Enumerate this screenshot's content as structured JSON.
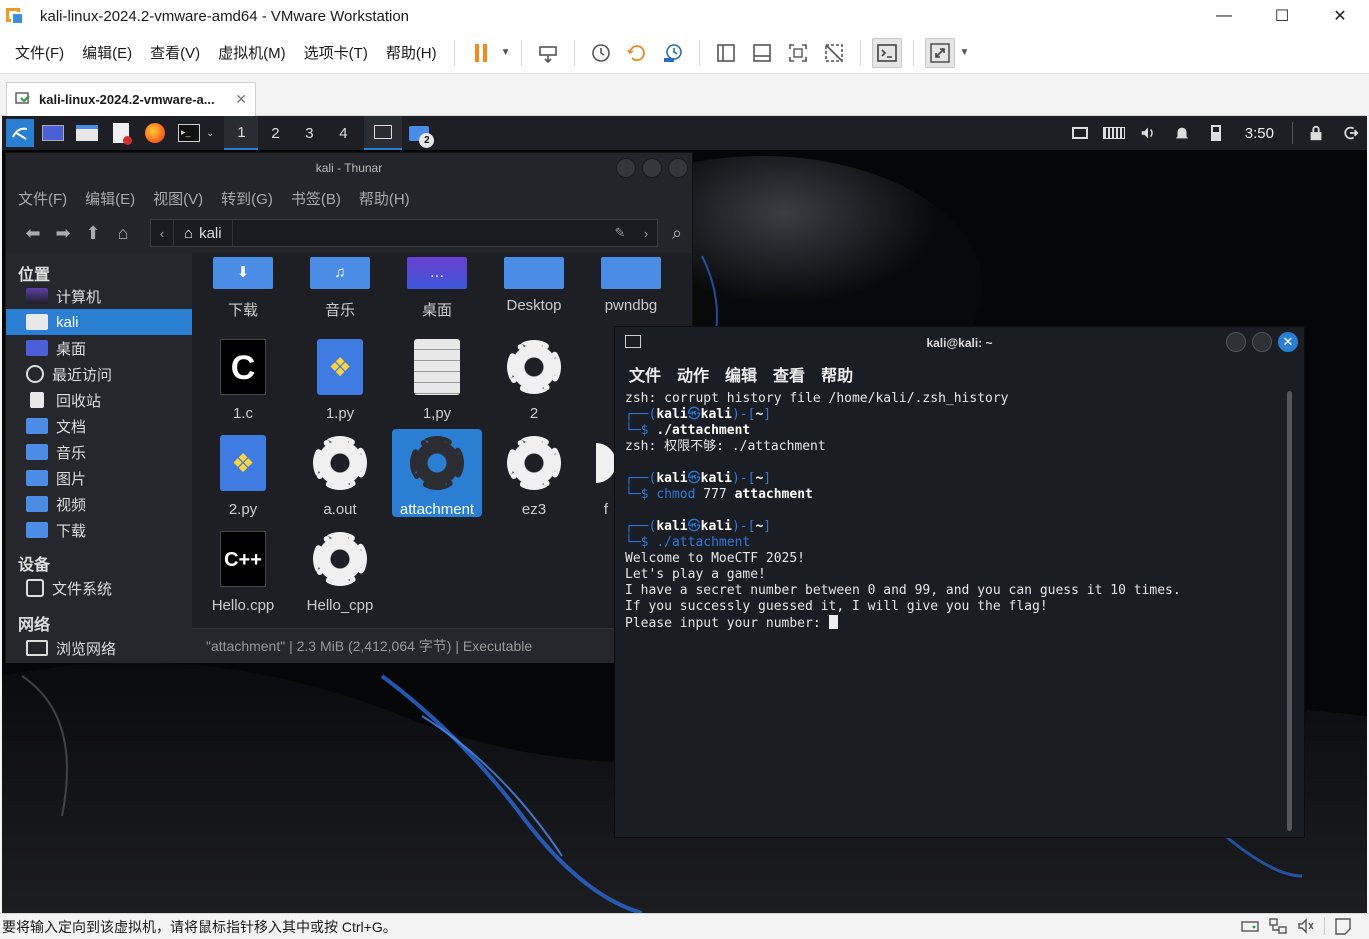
{
  "host": {
    "title": "kali-linux-2024.2-vmware-amd64 - VMware Workstation",
    "menus": [
      "文件(F)",
      "编辑(E)",
      "查看(V)",
      "虚拟机(M)",
      "选项卡(T)",
      "帮助(H)"
    ],
    "tab_label": "kali-linux-2024.2-vmware-a...",
    "status_text": "要将输入定向到该虚拟机，请将鼠标指针移入其中或按 Ctrl+G。"
  },
  "panel": {
    "workspaces": [
      "1",
      "2",
      "3",
      "4"
    ],
    "clock": "3:50",
    "badge": "2"
  },
  "thunar": {
    "title": "kali - Thunar",
    "menus": [
      "文件(F)",
      "编辑(E)",
      "视图(V)",
      "转到(G)",
      "书签(B)",
      "帮助(H)"
    ],
    "path": "kali",
    "side_headers": {
      "places": "位置",
      "devices": "设备",
      "network": "网络"
    },
    "places": [
      "计算机",
      "kali",
      "桌面",
      "最近访问",
      "回收站",
      "文档",
      "音乐",
      "图片",
      "视频",
      "下载"
    ],
    "devices": [
      "文件系统"
    ],
    "network": [
      "浏览网络"
    ],
    "files": [
      "下载",
      "音乐",
      "桌面",
      "Desktop",
      "pwndbg",
      "1.c",
      "1.py",
      "1,py",
      "2",
      "2.py",
      "a.out",
      "attachment",
      "ez3",
      "f",
      "Hello.cpp",
      "Hello_cpp"
    ],
    "status": "\"attachment\" | 2.3 MiB (2,412,064 字节) | Executable"
  },
  "terminal": {
    "title": "kali@kali: ~",
    "menus": [
      "文件",
      "动作",
      "编辑",
      "查看",
      "帮助"
    ],
    "lines": {
      "l1": "zsh: corrupt history file /home/kali/.zsh_history",
      "p_user": "kali",
      "p_host": "kali",
      "p_dir": "~",
      "c1": "./attachment",
      "l2": "zsh: 权限不够: ./attachment",
      "c2_cmd": "chmod",
      "c2_args": "777",
      "c2_file": "attachment",
      "c3": "./attachment",
      "o1": "Welcome to MoeCTF 2025!",
      "o2": "Let's play a game!",
      "o3": "I have a secret number between 0 and 99, and you can guess it 10 times.",
      "o4": "If you successly guessed it, I will give you the flag!",
      "o5": "Please input your number: "
    }
  },
  "colors": {
    "accent": "#2a7fd2",
    "terminal_bg": "#1b1d24",
    "folder": "#4b8de6"
  }
}
